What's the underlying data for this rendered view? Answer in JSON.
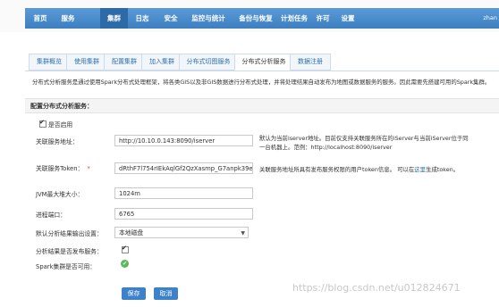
{
  "nav": {
    "items": [
      "首页",
      "服务",
      "集群",
      "日志",
      "安全",
      "监控与统计",
      "备份与恢复",
      "计划任务",
      "许可",
      "设置"
    ],
    "user": "zhan"
  },
  "tabs": [
    "集群概览",
    "使用集群",
    "配置集群",
    "加入集群",
    "分布式切图服务",
    "分布式分析服务",
    "数据注册"
  ],
  "active_tab": "分布式分析服务",
  "description": "分布式分析服务是通过使用Spark分布式处理框架，将各类GIS以及非GIS数据进行分布式处理，并将处理结果自动发布为地图或数据服务的服务。因此需要先搭建可用的Spark集群。",
  "section_title": "配置分布式分析服务：",
  "form": {
    "enable_label": "是否启用",
    "iserver_label": "关联服务地址：",
    "iserver_value": "http://10.10.0.143:8090/iserver",
    "iserver_hint_1": "默认为当前iserver地址。目前仅支持关联服务所在的iServer与当前iServer位于同",
    "iserver_hint_2": "一台机器上。范例：http://localhost:8090/iserver",
    "token_label": "关联服务Token：",
    "token_value": "dRthF7l754rIEkAqlGf2QzXasmp_G7anpk39e",
    "token_hint_prefix": "关联服务地址所具有发布服务权限的用户token信息。 可以在",
    "token_hint_link": "这里",
    "token_hint_suffix": "生成token。",
    "jvm_label": "JVM最大堆大小：",
    "jvm_value": "1024m",
    "port_label": "进程端口：",
    "port_value": "6765",
    "output_label": "默认分析结果输出设置：",
    "output_value": "本地磁盘",
    "publish_label": "分析结果是否发布服务：",
    "spark_label": "Spark集群是否可用："
  },
  "buttons": {
    "save": "保存",
    "cancel": "取消"
  },
  "watermark": "https://blog.csdn.net/u012824671",
  "colors": {
    "nav": "#4a8ccd",
    "accent": "#3d82c9",
    "ok": "#5cb85c"
  }
}
